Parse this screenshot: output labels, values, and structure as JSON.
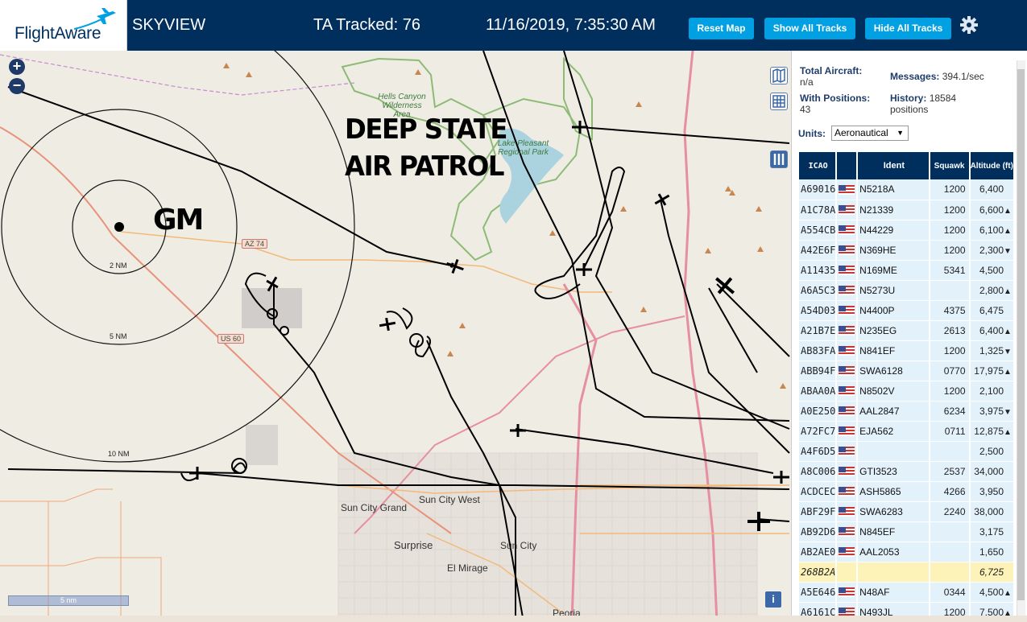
{
  "header": {
    "logo_text": "FlightAware",
    "app_title": "SKYVIEW",
    "tracked": "TA Tracked: 76",
    "datetime": "11/16/2019, 7:35:30 AM",
    "btn_reset": "Reset Map",
    "btn_show": "Show All Tracks",
    "btn_hide": "Hide All Tracks"
  },
  "map": {
    "zoom_in": "+",
    "zoom_out": "−",
    "overlay_line1": "DEEP STATE",
    "overlay_line2": "AIR PATROL",
    "gm_label": "GM",
    "ring_2nm": "2 NM",
    "ring_5nm": "5 NM",
    "ring_10nm": "10 NM",
    "scale": "5 nm",
    "info": "i",
    "places": {
      "hells_canyon": "Hells Canyon Wilderness Area",
      "lake_pleasant": "Lake Pleasant Regional Park",
      "sun_city_grand": "Sun City Grand",
      "sun_city_west": "Sun City West",
      "surprise": "Surprise",
      "sun_city": "Sun City",
      "el_mirage": "El Mirage",
      "peoria": "Peoria"
    },
    "shields": {
      "az74": "AZ 74",
      "us60": "US 60"
    }
  },
  "sidebar": {
    "total_aircraft_label": "Total Aircraft:",
    "total_aircraft_value": "n/a",
    "with_positions_label": "With Positions:",
    "with_positions_value": "43",
    "messages_label": "Messages:",
    "messages_value": "394.1/sec",
    "history_label": "History:",
    "history_value": "18584",
    "history_unit": "positions",
    "units_label": "Units:",
    "units_value": "Aeronautical",
    "columns": {
      "icao": "ICAO",
      "ident": "Ident",
      "squawk": "Squawk",
      "altitude": "Altitude (ft)"
    },
    "rows": [
      {
        "icao": "A69016",
        "ident": "N5218A",
        "squawk": "1200",
        "alt": "6,400",
        "trend": ""
      },
      {
        "icao": "A1C78A",
        "ident": "N21339",
        "squawk": "1200",
        "alt": "6,600",
        "trend": "▲"
      },
      {
        "icao": "A554CB",
        "ident": "N44229",
        "squawk": "1200",
        "alt": "6,100",
        "trend": "▲"
      },
      {
        "icao": "A42E6F",
        "ident": "N369HE",
        "squawk": "1200",
        "alt": "2,300",
        "trend": "▼"
      },
      {
        "icao": "A11435",
        "ident": "N169ME",
        "squawk": "5341",
        "alt": "4,500",
        "trend": ""
      },
      {
        "icao": "A6A5C3",
        "ident": "N5273U",
        "squawk": "",
        "alt": "2,800",
        "trend": "▲"
      },
      {
        "icao": "A54D03",
        "ident": "N4400P",
        "squawk": "4375",
        "alt": "6,475",
        "trend": ""
      },
      {
        "icao": "A21B7E",
        "ident": "N235EG",
        "squawk": "2613",
        "alt": "6,400",
        "trend": "▲"
      },
      {
        "icao": "AB83FA",
        "ident": "N841EF",
        "squawk": "1200",
        "alt": "1,325",
        "trend": "▼"
      },
      {
        "icao": "ABB94F",
        "ident": "SWA6128",
        "squawk": "0770",
        "alt": "17,975",
        "trend": "▲"
      },
      {
        "icao": "ABAA0A",
        "ident": "N8502V",
        "squawk": "1200",
        "alt": "2,100",
        "trend": ""
      },
      {
        "icao": "A0E250",
        "ident": "AAL2847",
        "squawk": "6234",
        "alt": "3,975",
        "trend": "▼"
      },
      {
        "icao": "A72FC7",
        "ident": "EJA562",
        "squawk": "0711",
        "alt": "12,875",
        "trend": "▲"
      },
      {
        "icao": "A4F6D5",
        "ident": "",
        "squawk": "",
        "alt": "2,500",
        "trend": ""
      },
      {
        "icao": "A8C006",
        "ident": "GTI3523",
        "squawk": "2537",
        "alt": "34,000",
        "trend": ""
      },
      {
        "icao": "ACDCEC",
        "ident": "ASH5865",
        "squawk": "4266",
        "alt": "3,950",
        "trend": ""
      },
      {
        "icao": "ABF29F",
        "ident": "SWA6283",
        "squawk": "2240",
        "alt": "38,000",
        "trend": ""
      },
      {
        "icao": "AB92D6",
        "ident": "N845EF",
        "squawk": "",
        "alt": "3,175",
        "trend": ""
      },
      {
        "icao": "AB2AE0",
        "ident": "AAL2053",
        "squawk": "",
        "alt": "1,650",
        "trend": ""
      },
      {
        "icao": "268B2A",
        "ident": "",
        "squawk": "",
        "alt": "6,725",
        "trend": "",
        "highlight": true
      },
      {
        "icao": "A5E646",
        "ident": "N48AF",
        "squawk": "0344",
        "alt": "4,500",
        "trend": "▲"
      },
      {
        "icao": "A6161C",
        "ident": "N493JL",
        "squawk": "1200",
        "alt": "7,500",
        "trend": "▲"
      }
    ]
  },
  "colors": {
    "header_bg": "#002f5d",
    "button_bg": "#00a0e2",
    "map_bg": "#efece4",
    "row_bg": "#e3f1fb",
    "highlight_row": "#fdf2b8"
  }
}
